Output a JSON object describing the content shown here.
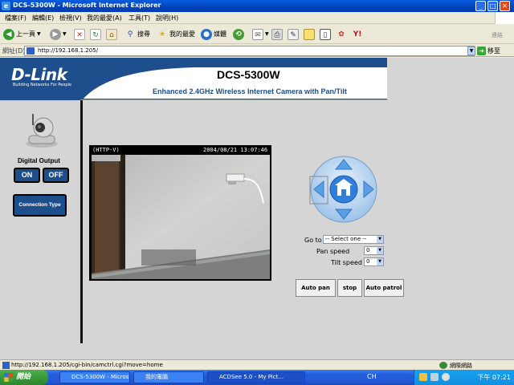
{
  "window": {
    "title": "DCS-5300W - Microsoft Internet Explorer",
    "controls": [
      "_",
      "□",
      "✕"
    ]
  },
  "menu": {
    "items": [
      "檔案(F)",
      "編輯(E)",
      "檢視(V)",
      "我的最愛(A)",
      "工具(T)",
      "說明(H)"
    ]
  },
  "toolbar": {
    "back_label": "上一頁",
    "search_label": "搜尋",
    "favorites_label": "我的最愛",
    "media_label": "媒體"
  },
  "address": {
    "label": "網址(D)",
    "url": "http://192.168.1.205/",
    "go_label": "移至",
    "links_label": "連結"
  },
  "page": {
    "logo": "D-Link",
    "logo_tagline": "Building Networks For People",
    "model": "DCS-5300W",
    "subtitle": "Enhanced 2.4GHz Wireless Internet Camera with Pan/Tilt"
  },
  "sidebar": {
    "digital_output_label": "Digital Output",
    "on_label": "ON",
    "off_label": "OFF",
    "connection_type_label": "Connection Type"
  },
  "video": {
    "mode_label": "(HTTP-V)",
    "timestamp": "2004/08/21  13:07:46"
  },
  "ptz": {
    "goto_label": "Go to",
    "goto_value": "-- Select one --",
    "pan_speed_label": "Pan speed",
    "pan_speed_value": "0",
    "tilt_speed_label": "Tilt speed",
    "tilt_speed_value": "0",
    "auto_pan_label": "Auto pan",
    "stop_label": "stop",
    "auto_patrol_label": "Auto patrol"
  },
  "statusbar": {
    "text": "http://192.168.1.205/cgi-bin/camctrl.cgi?move=home",
    "zone": "網際網路"
  },
  "taskbar": {
    "start_label": "開始",
    "tasks": [
      "DCS-5300W - Micros...",
      "我的電腦",
      "ACDSee 5.0 - My Pict..."
    ],
    "lang": "CH",
    "clock": "下午 07:21"
  },
  "colors": {
    "dlink_blue": "#1f4e8c",
    "subtitle_blue": "#1e4d8a",
    "page_grey": "#d5d5d5",
    "ptz_blue": "#5aa0e6"
  }
}
